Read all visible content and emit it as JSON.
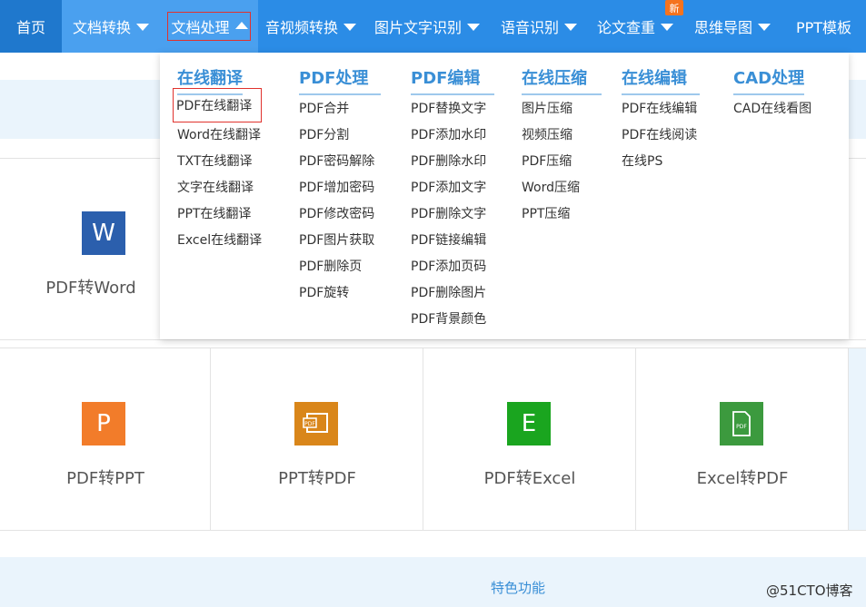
{
  "nav": {
    "items": [
      {
        "label": "首页"
      },
      {
        "label": "文档转换"
      },
      {
        "label": "文档处理"
      },
      {
        "label": "音视频转换"
      },
      {
        "label": "图片文字识别"
      },
      {
        "label": "语音识别"
      },
      {
        "label": "论文查重"
      },
      {
        "label": "思维导图"
      },
      {
        "label": "PPT模板"
      }
    ],
    "new_badge": "新"
  },
  "dropdown": {
    "columns": [
      {
        "title": "在线翻译",
        "items": [
          "PDF在线翻译",
          "Word在线翻译",
          "TXT在线翻译",
          "文字在线翻译",
          "PPT在线翻译",
          "Excel在线翻译"
        ]
      },
      {
        "title": "PDF处理",
        "items": [
          "PDF合并",
          "PDF分割",
          "PDF密码解除",
          "PDF增加密码",
          "PDF修改密码",
          "PDF图片获取",
          "PDF删除页",
          "PDF旋转"
        ]
      },
      {
        "title": "PDF编辑",
        "items": [
          "PDF替换文字",
          "PDF添加水印",
          "PDF删除水印",
          "PDF添加文字",
          "PDF删除文字",
          "PDF链接编辑",
          "PDF添加页码",
          "PDF删除图片",
          "PDF背景颜色"
        ]
      },
      {
        "title": "在线压缩",
        "items": [
          "图片压缩",
          "视频压缩",
          "PDF压缩",
          "Word压缩",
          "PPT压缩"
        ]
      },
      {
        "title": "在线编辑",
        "items": [
          "PDF在线编辑",
          "PDF在线阅读",
          "在线PS"
        ]
      },
      {
        "title": "CAD处理",
        "items": [
          "CAD在线看图"
        ]
      }
    ]
  },
  "tools": {
    "row1": [
      {
        "label": "PDF转Word",
        "icon": "word-icon",
        "glyph": "W",
        "color": "#2b5fad"
      }
    ],
    "row2": [
      {
        "label": "PDF转PPT",
        "icon": "ppt-icon",
        "glyph": "P",
        "color": "#f27c2a"
      },
      {
        "label": "PPT转PDF",
        "icon": "ppt-to-pdf-icon",
        "glyph": "PDF",
        "color": "#d9861a"
      },
      {
        "label": "PDF转Excel",
        "icon": "excel-icon",
        "glyph": "E",
        "color": "#1aa51f"
      },
      {
        "label": "Excel转PDF",
        "icon": "excel-to-pdf-icon",
        "glyph": "PDF",
        "color": "#3c9a3e"
      }
    ]
  },
  "features_label": "特色功能",
  "watermark": "@51CTO博客",
  "colors": {
    "nav": "#2b8ce6",
    "accent": "#3a8fd6",
    "highlight": "#e0322d"
  }
}
